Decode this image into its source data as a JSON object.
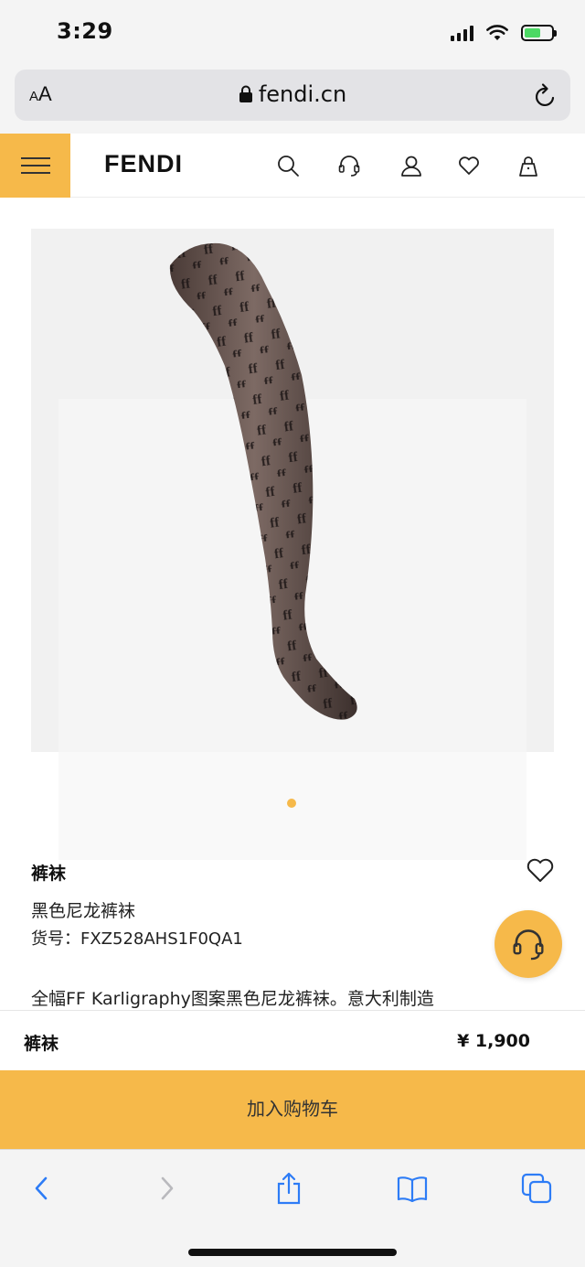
{
  "status": {
    "time": "3:29",
    "battery_level": 0.6,
    "battery_color": "#4cd964"
  },
  "browser": {
    "text_size_label_small": "A",
    "text_size_label_large": "A",
    "url": "fendi.cn",
    "icons": [
      "lock-icon",
      "reload-icon",
      "back-icon",
      "forward-icon",
      "share-icon",
      "bookmarks-icon",
      "tabs-icon"
    ]
  },
  "header": {
    "logo": "FENDI",
    "accent_color": "#f6b94a",
    "icons": [
      "menu-icon",
      "search-icon",
      "customer-service-icon",
      "account-icon",
      "wishlist-icon",
      "shopping-bag-icon"
    ]
  },
  "gallery": {
    "current_index": 1,
    "total": 1
  },
  "product": {
    "category": "裤袜",
    "name": "黑色尼龙裤袜",
    "code_label": "货号：",
    "code": "FXZ528AHS1F0QA1",
    "description": "全幅FF Karligraphy图案黑色尼龙裤袜。意大利制造"
  },
  "purchase": {
    "item_name": "裤袜",
    "price": "¥ 1,900",
    "add_to_cart": "加入购物车"
  }
}
